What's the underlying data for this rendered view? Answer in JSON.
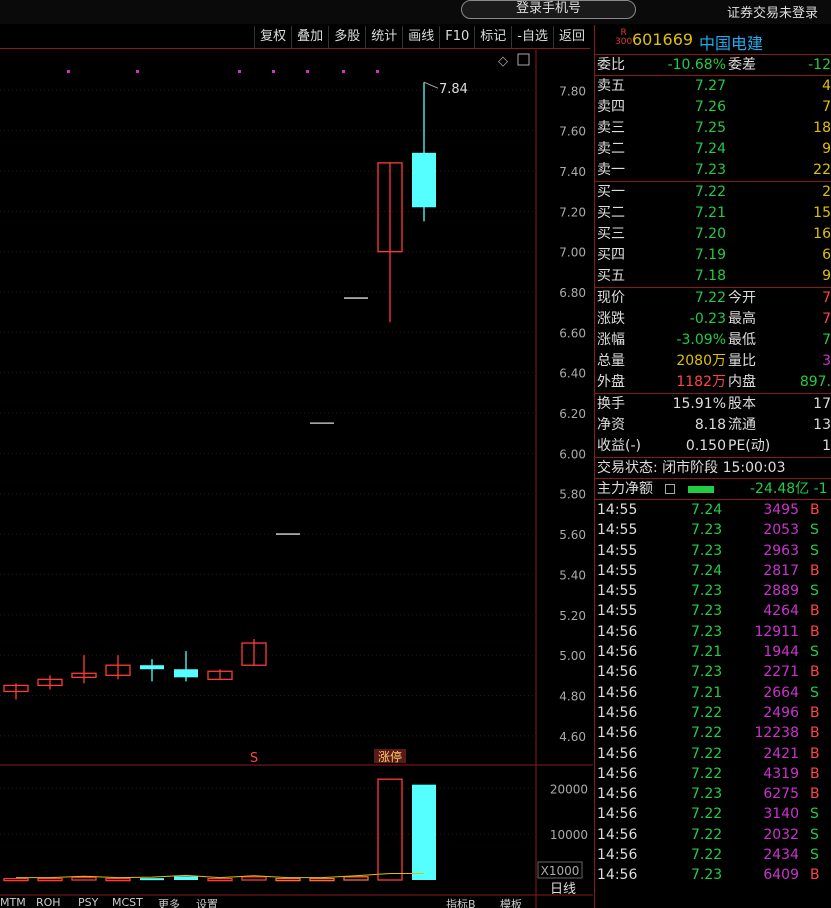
{
  "topbar": {
    "login_label": "登录手机号",
    "status": "证券交易未登录"
  },
  "toolbar": [
    "复权",
    "叠加",
    "多股",
    "统计",
    "画线",
    "F10",
    "标记",
    "-自选",
    "返回"
  ],
  "stock": {
    "board": "R",
    "board_num": "300",
    "code": "601669",
    "name": "中国电建"
  },
  "order_ratio": {
    "label": "委比",
    "value": "-10.68%",
    "label2": "委差",
    "value2": "-12"
  },
  "asks": [
    {
      "label": "卖五",
      "price": "7.27",
      "vol": "4"
    },
    {
      "label": "卖四",
      "price": "7.26",
      "vol": "7"
    },
    {
      "label": "卖三",
      "price": "7.25",
      "vol": "18"
    },
    {
      "label": "卖二",
      "price": "7.24",
      "vol": "9"
    },
    {
      "label": "卖一",
      "price": "7.23",
      "vol": "22"
    }
  ],
  "bids": [
    {
      "label": "买一",
      "price": "7.22",
      "vol": "2"
    },
    {
      "label": "买二",
      "price": "7.21",
      "vol": "15"
    },
    {
      "label": "买三",
      "price": "7.20",
      "vol": "16"
    },
    {
      "label": "买四",
      "price": "7.19",
      "vol": "6"
    },
    {
      "label": "买五",
      "price": "7.18",
      "vol": "9"
    }
  ],
  "stats1": [
    {
      "l1": "现价",
      "v1": "7.22",
      "c1": "green",
      "l2": "今开",
      "v2": "7",
      "c2": "red"
    },
    {
      "l1": "涨跌",
      "v1": "-0.23",
      "c1": "green",
      "l2": "最高",
      "v2": "7",
      "c2": "red"
    },
    {
      "l1": "涨幅",
      "v1": "-3.09%",
      "c1": "green",
      "l2": "最低",
      "v2": "7",
      "c2": "green"
    },
    {
      "l1": "总量",
      "v1": "2080万",
      "c1": "yellow",
      "l2": "量比",
      "v2": "3",
      "c2": "purple"
    },
    {
      "l1": "外盘",
      "v1": "1182万",
      "c1": "red",
      "l2": "内盘",
      "v2": "897.",
      "c2": "green"
    }
  ],
  "stats2": [
    {
      "l1": "换手",
      "v1": "15.91%",
      "c1": "white",
      "l2": "股本",
      "v2": "17",
      "c2": "white"
    },
    {
      "l1": "净资",
      "v1": "8.18",
      "c1": "white",
      "l2": "流通",
      "v2": "13",
      "c2": "white"
    },
    {
      "l1": "收益(-)",
      "v1": "0.150",
      "c1": "white",
      "l2": "PE(动)",
      "v2": "1",
      "c2": "white"
    }
  ],
  "trade_status": "交易状态: 闭市阶段 15:00:03",
  "main_flow": {
    "label": "主力净额",
    "value": "-24.48亿 -1"
  },
  "ticks": [
    {
      "t": "14:55",
      "p": "7.24",
      "v": "3495",
      "bs": "B"
    },
    {
      "t": "14:55",
      "p": "7.23",
      "v": "2053",
      "bs": "S"
    },
    {
      "t": "14:55",
      "p": "7.23",
      "v": "2963",
      "bs": "S"
    },
    {
      "t": "14:55",
      "p": "7.24",
      "v": "2817",
      "bs": "B"
    },
    {
      "t": "14:55",
      "p": "7.23",
      "v": "2889",
      "bs": "S"
    },
    {
      "t": "14:55",
      "p": "7.23",
      "v": "4264",
      "bs": "B"
    },
    {
      "t": "14:56",
      "p": "7.23",
      "v": "12911",
      "bs": "B"
    },
    {
      "t": "14:56",
      "p": "7.21",
      "v": "1944",
      "bs": "S"
    },
    {
      "t": "14:56",
      "p": "7.23",
      "v": "2271",
      "bs": "B"
    },
    {
      "t": "14:56",
      "p": "7.21",
      "v": "2664",
      "bs": "S"
    },
    {
      "t": "14:56",
      "p": "7.22",
      "v": "2496",
      "bs": "B"
    },
    {
      "t": "14:56",
      "p": "7.22",
      "v": "12238",
      "bs": "B"
    },
    {
      "t": "14:56",
      "p": "7.22",
      "v": "2421",
      "bs": "B"
    },
    {
      "t": "14:56",
      "p": "7.22",
      "v": "4319",
      "bs": "B"
    },
    {
      "t": "14:56",
      "p": "7.23",
      "v": "6275",
      "bs": "B"
    },
    {
      "t": "14:56",
      "p": "7.22",
      "v": "3140",
      "bs": "S"
    },
    {
      "t": "14:56",
      "p": "7.22",
      "v": "2032",
      "bs": "S"
    },
    {
      "t": "14:56",
      "p": "7.22",
      "v": "2434",
      "bs": "S"
    },
    {
      "t": "14:56",
      "p": "7.23",
      "v": "6409",
      "bs": "B"
    }
  ],
  "chart_data": {
    "type": "candlestick",
    "price_ticks": [
      "7.80",
      "7.60",
      "7.40",
      "7.20",
      "7.00",
      "6.80",
      "6.60",
      "6.40",
      "6.20",
      "6.00",
      "5.80",
      "5.60",
      "5.40",
      "5.20",
      "5.00",
      "4.80",
      "4.60"
    ],
    "ylim": [
      4.5,
      7.95
    ],
    "high_annotation": "7.84",
    "candles": [
      {
        "o": 4.82,
        "h": 4.86,
        "l": 4.78,
        "c": 4.85,
        "color": "red"
      },
      {
        "o": 4.85,
        "h": 4.9,
        "l": 4.83,
        "c": 4.88,
        "color": "red"
      },
      {
        "o": 4.89,
        "h": 5.0,
        "l": 4.86,
        "c": 4.91,
        "color": "red"
      },
      {
        "o": 4.9,
        "h": 5.0,
        "l": 4.88,
        "c": 4.95,
        "color": "red"
      },
      {
        "o": 4.95,
        "h": 4.98,
        "l": 4.87,
        "c": 4.93,
        "color": "cyan"
      },
      {
        "o": 4.93,
        "h": 5.02,
        "l": 4.87,
        "c": 4.89,
        "color": "cyan"
      },
      {
        "o": 4.88,
        "h": 4.93,
        "l": 4.88,
        "c": 4.92,
        "color": "red"
      },
      {
        "o": 4.95,
        "h": 5.08,
        "l": 4.95,
        "c": 5.06,
        "color": "red"
      },
      {
        "o": 5.6,
        "h": 5.6,
        "l": 5.6,
        "c": 5.6,
        "color": "white"
      },
      {
        "o": 6.15,
        "h": 6.15,
        "l": 6.15,
        "c": 6.15,
        "color": "white"
      },
      {
        "o": 6.77,
        "h": 6.77,
        "l": 6.77,
        "c": 6.77,
        "color": "white"
      },
      {
        "o": 7.0,
        "h": 7.44,
        "l": 6.65,
        "c": 7.44,
        "color": "red"
      },
      {
        "o": 7.49,
        "h": 7.84,
        "l": 7.15,
        "c": 7.22,
        "color": "cyan"
      }
    ],
    "volume_ticks": [
      "20000",
      "10000"
    ],
    "volume_unit": "X1000",
    "volumes": [
      300,
      300,
      600,
      300,
      400,
      800,
      300,
      700,
      300,
      300,
      700,
      22000,
      20800
    ],
    "events": [
      {
        "candle": 7,
        "text": "S"
      },
      {
        "candle": 11,
        "text": "涨停"
      }
    ],
    "period_label": "日线"
  },
  "bottom_tabs": [
    "MTM",
    "ROH",
    "PSY",
    "MCST",
    "更多",
    "设置",
    "指标B",
    "模板"
  ],
  "colors": {
    "up": "#ff3b3b",
    "down": "#55ffff",
    "flat": "#dddddd",
    "frame": "#8a1a1a"
  }
}
